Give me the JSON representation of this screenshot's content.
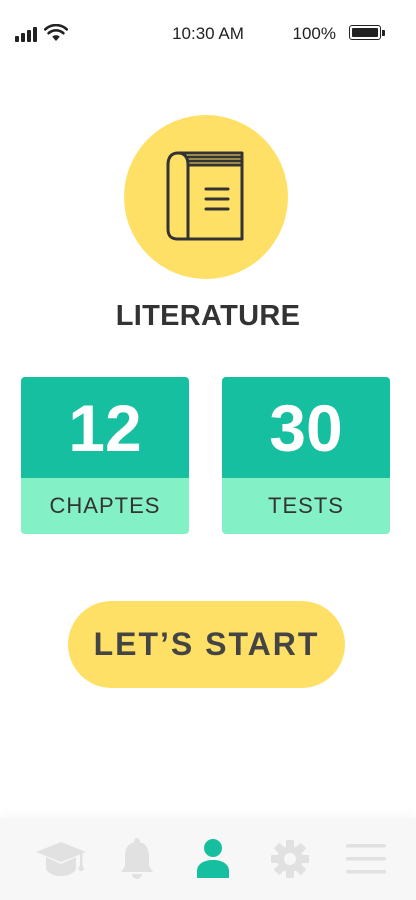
{
  "status_bar": {
    "time": "10:30 AM",
    "battery_percent": "100%",
    "battery_level": 1.0,
    "icons": [
      "cellular-signal-icon",
      "wifi-icon",
      "battery-icon"
    ]
  },
  "subject": {
    "title": "LITERATURE",
    "icon": "book-icon"
  },
  "stats": [
    {
      "value": "12",
      "label": "CHAPTES"
    },
    {
      "value": "30",
      "label": "TESTS"
    }
  ],
  "start_button": {
    "label": "LET’S START"
  },
  "tab_bar": {
    "items": [
      {
        "icon": "graduation-cap-icon",
        "active": false
      },
      {
        "icon": "bell-icon",
        "active": false
      },
      {
        "icon": "user-icon",
        "active": true
      },
      {
        "icon": "gear-icon",
        "active": false
      },
      {
        "icon": "menu-icon",
        "active": false
      }
    ]
  },
  "colors": {
    "accent_yellow": "#ffe066",
    "stat_dark": "#16bf9f",
    "stat_light": "#84f0c6",
    "active_tab": "#16bf9f",
    "inactive_tab": "#e1e1e1",
    "text_dark": "#333333"
  }
}
